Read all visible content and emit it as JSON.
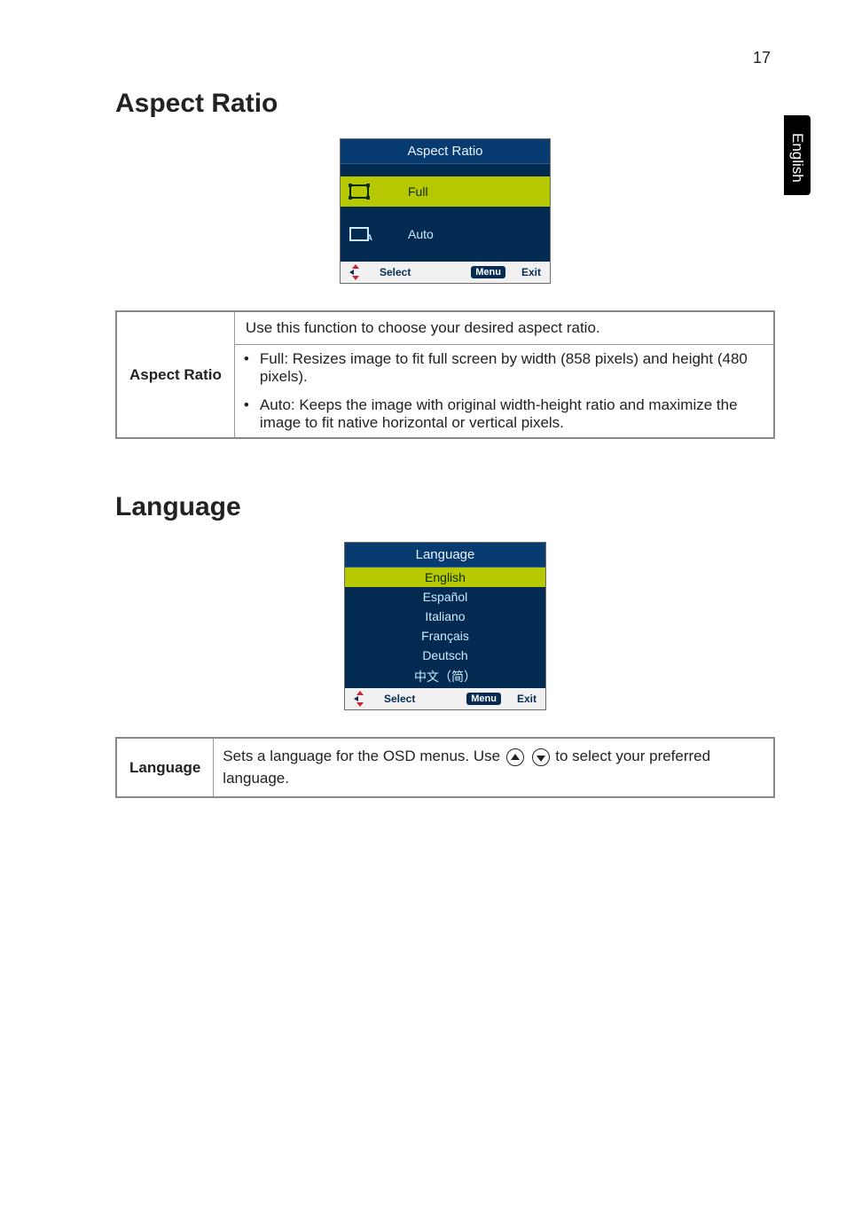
{
  "page_number": "17",
  "side_tab": "English",
  "sections": {
    "aspect_ratio": {
      "heading": "Aspect Ratio",
      "osd": {
        "title": "Aspect Ratio",
        "options": {
          "full": "Full",
          "auto": "Auto"
        },
        "footer": {
          "select": "Select",
          "menu": "Menu",
          "exit": "Exit"
        }
      },
      "table": {
        "label": "Aspect Ratio",
        "intro": "Use this function to choose your desired aspect ratio.",
        "bullets": [
          "Full: Resizes image to fit full screen by width (858 pixels) and height (480 pixels).",
          "Auto: Keeps the image with original width-height ratio and maximize the image to fit native horizontal or vertical pixels."
        ]
      }
    },
    "language": {
      "heading": "Language",
      "osd": {
        "title": "Language",
        "items": [
          "English",
          "Español",
          "Italiano",
          "Français",
          "Deutsch",
          "中文（简）"
        ],
        "footer": {
          "select": "Select",
          "menu": "Menu",
          "exit": "Exit"
        }
      },
      "table": {
        "label": "Language",
        "desc_pre": "Sets a language for the OSD menus. Use ",
        "desc_post": " to select your preferred language."
      }
    }
  }
}
